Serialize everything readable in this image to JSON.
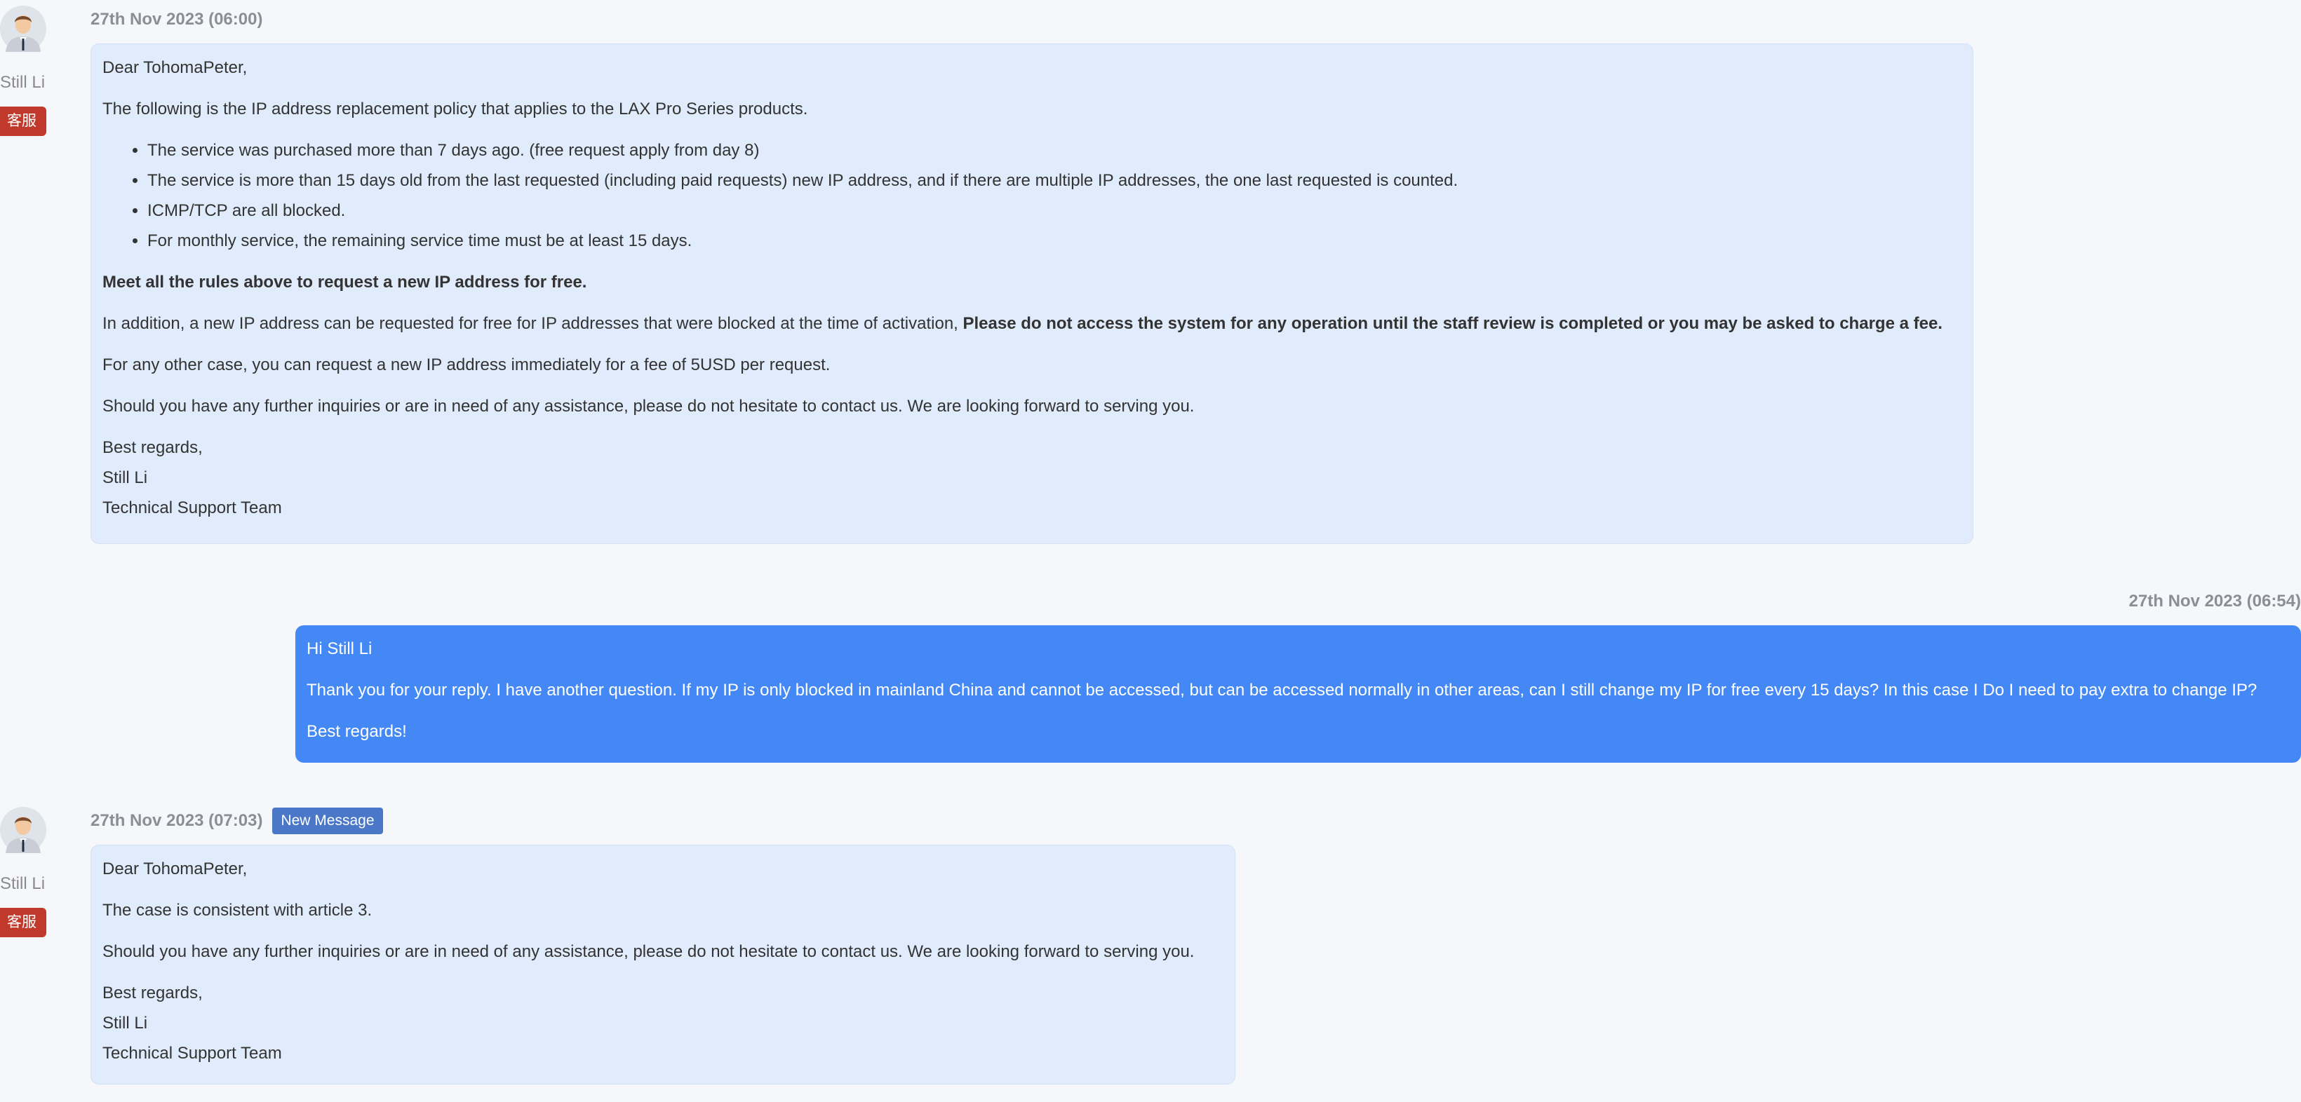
{
  "messages": [
    {
      "timestamp": "27th Nov 2023 (06:00)",
      "agent": {
        "name": "Still Li",
        "badge": "客服",
        "avatar_icon": "user-avatar-icon"
      },
      "greeting": "Dear TohomaPeter,",
      "intro": "The following is the IP address replacement policy that applies to the LAX Pro Series products.",
      "rules": [
        "The service was purchased more than 7 days ago. (free request apply from day 8)",
        "The service is more than 15 days old from the last requested (including paid requests) new IP address, and if there are multiple IP addresses, the one last requested is counted.",
        "ICMP/TCP are all blocked.",
        "For monthly service, the remaining service time must be at least 15 days."
      ],
      "rules_summary": "Meet all the rules above to request a new IP address for free.",
      "addition_text": "In addition, a new IP address can be requested for free for IP addresses that were blocked at the time of activation,",
      "addition_bold": "Please do not access the system for any operation until the staff review is completed or you may be asked to charge a fee.",
      "fee_text": "For any other case, you can request a new IP address immediately for a fee of 5USD per request.",
      "closing": "Should you have any further inquiries or are in need of any assistance, please do not hesitate to contact us. We are looking forward to serving you.",
      "signature": [
        "Best regards,",
        "Still Li",
        "Technical Support Team"
      ]
    },
    {
      "timestamp": "27th Nov 2023 (06:54)",
      "lines": [
        "Hi Still Li",
        "Thank you for your reply. I have another question. If my IP is only blocked in mainland China and cannot be accessed, but can be accessed normally in other areas, can I still change my IP for free every 15 days? In this case I Do I need to pay extra to change IP?",
        "Best regards!"
      ]
    },
    {
      "timestamp": "27th Nov 2023 (07:03)",
      "new_label": "New Message",
      "agent": {
        "name": "Still Li",
        "badge": "客服",
        "avatar_icon": "user-avatar-icon"
      },
      "greeting": "Dear TohomaPeter,",
      "body": "The case is consistent with article 3.",
      "closing": "Should you have any further inquiries or are in need of any assistance, please do not hesitate to contact us. We are looking forward to serving you.",
      "signature": [
        "Best regards,",
        "Still Li",
        "Technical Support Team"
      ]
    }
  ],
  "colors": {
    "page_bg": "#f5f7fa",
    "agent_bubble": "#e0ecfb",
    "user_bubble": "#4488f5",
    "agent_badge": "#c0392b",
    "new_badge": "#4a77c8",
    "timestamp": "#8a8f96"
  }
}
